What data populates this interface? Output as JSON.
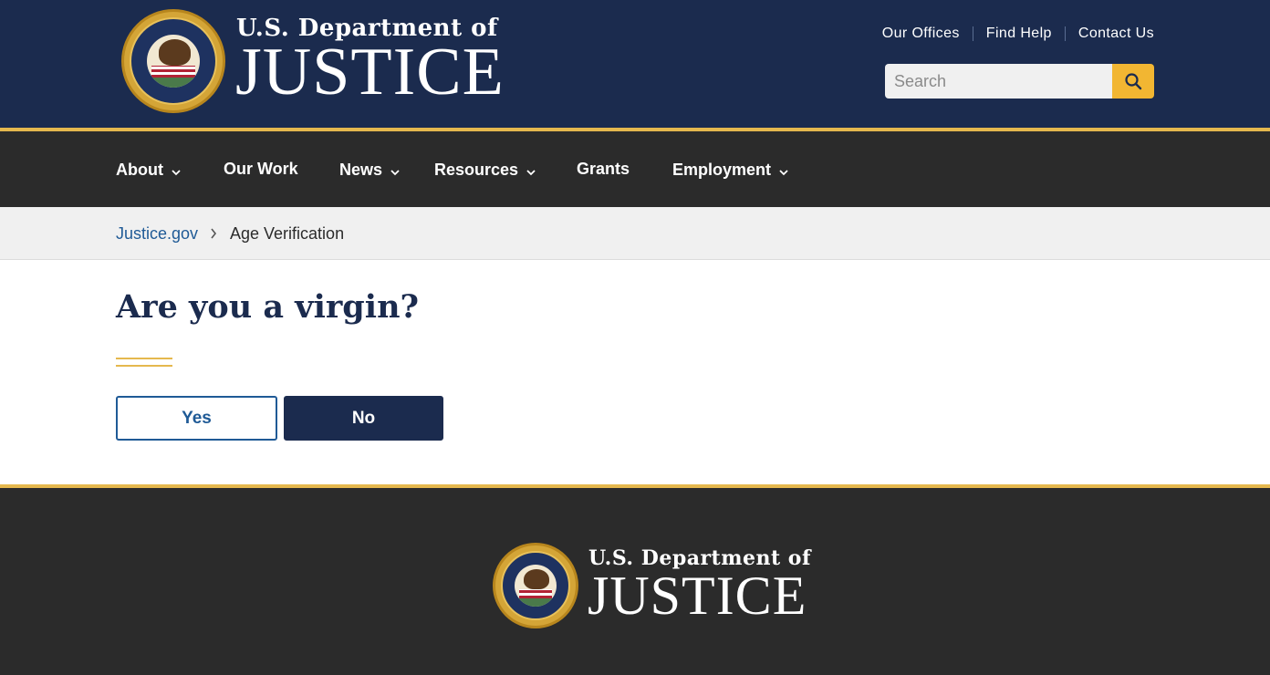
{
  "header": {
    "brand_line1": "U.S. Department of",
    "brand_line2": "JUSTICE",
    "utility_links": [
      "Our Offices",
      "Find Help",
      "Contact Us"
    ],
    "search_placeholder": "Search",
    "search_icon": "search-icon",
    "colors": {
      "background": "#1b2b4e",
      "accent": "#e5b84e",
      "search_button": "#f2b632"
    }
  },
  "nav": {
    "items": [
      {
        "label": "About",
        "has_dropdown": true
      },
      {
        "label": "Our Work",
        "has_dropdown": false
      },
      {
        "label": "News",
        "has_dropdown": true
      },
      {
        "label": "Resources",
        "has_dropdown": true
      },
      {
        "label": "Grants",
        "has_dropdown": false
      },
      {
        "label": "Employment",
        "has_dropdown": true
      }
    ],
    "background": "#2b2b2b"
  },
  "breadcrumb": {
    "home_label": "Justice.gov",
    "separator_icon": "chevron-right-icon",
    "current": "Age Verification"
  },
  "main": {
    "title": "Are you a virgin?",
    "yes_label": "Yes",
    "no_label": "No"
  },
  "footer": {
    "brand_line1": "U.S. Department of",
    "brand_line2": "JUSTICE",
    "background": "#2b2b2b"
  }
}
